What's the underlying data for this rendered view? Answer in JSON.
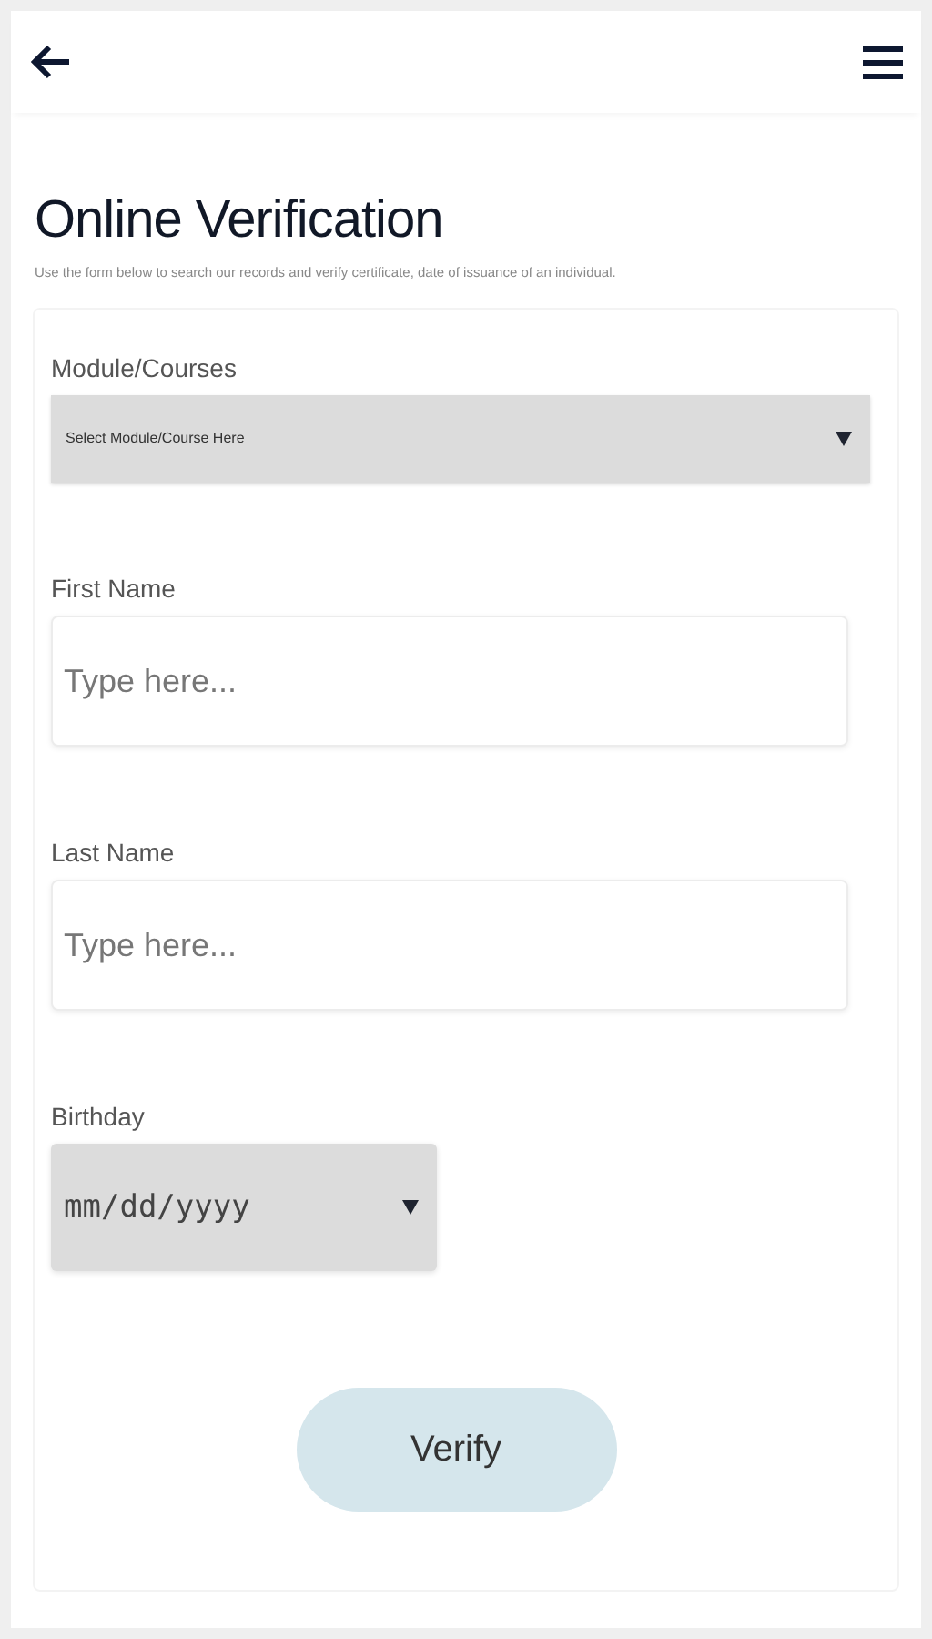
{
  "header": {
    "title": "Online Verification",
    "description": "Use the form below to search our records and verify certificate, date of issuance of an individual."
  },
  "fields": [
    {
      "kind": "select",
      "label": "Module/Courses",
      "placeholder": "Select Module/Course Here"
    },
    {
      "kind": "text",
      "label": "First Name",
      "placeholder": "Type here..."
    },
    {
      "kind": "text",
      "label": "Last Name",
      "placeholder": "Type here..."
    },
    {
      "kind": "date",
      "label": "Birthday",
      "placeholder": "mm/dd/yyyy"
    }
  ],
  "submit": "Verify"
}
